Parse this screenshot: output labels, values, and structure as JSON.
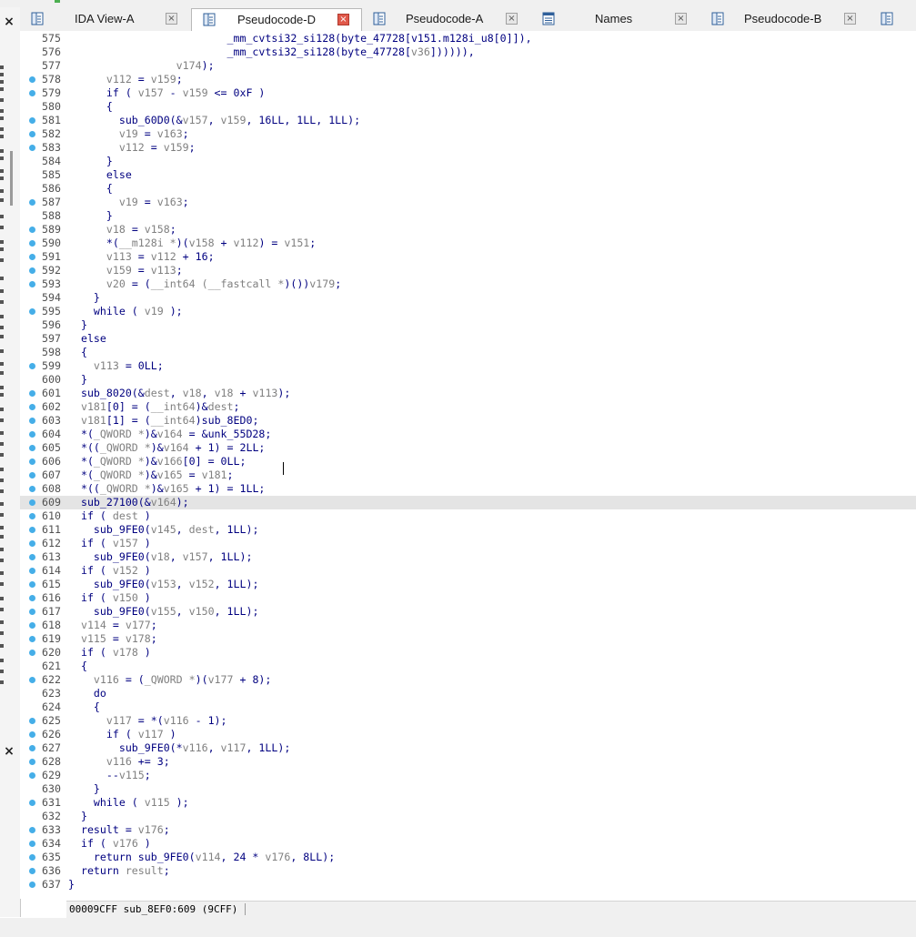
{
  "tabs": [
    {
      "label": "IDA View-A",
      "icon": "disassembly-icon",
      "active": false
    },
    {
      "label": "Pseudocode-D",
      "icon": "pseudocode-icon",
      "active": true
    },
    {
      "label": "Pseudocode-A",
      "icon": "pseudocode-icon",
      "active": false
    },
    {
      "label": "Names",
      "icon": "names-icon",
      "active": false
    },
    {
      "label": "Pseudocode-B",
      "icon": "pseudocode-icon",
      "active": false
    }
  ],
  "close_glyph": "×",
  "left_panel": {
    "close_glyph": "×"
  },
  "current_line": 609,
  "code_lines": [
    {
      "n": "575",
      "bp": false,
      "segs": [
        [
          "                         ",
          ""
        ],
        [
          "_mm_cvtsi32_si128(byte_47728[",
          ""
        ],
        [
          "v151",
          ""
        ],
        [
          ".m128i_u8[0]]),",
          ""
        ]
      ]
    },
    {
      "n": "576",
      "bp": false,
      "segs": [
        [
          "                         _mm_cvtsi32_si128(byte_47728[",
          ""
        ],
        [
          "v36",
          "v"
        ],
        [
          "]))))),",
          ""
        ]
      ]
    },
    {
      "n": "577",
      "bp": false,
      "segs": [
        [
          "                 ",
          ""
        ],
        [
          "v174",
          "v"
        ],
        [
          ");",
          ""
        ]
      ]
    },
    {
      "n": "578",
      "bp": true,
      "segs": [
        [
          "      ",
          ""
        ],
        [
          "v112",
          "v"
        ],
        [
          " = ",
          ""
        ],
        [
          "v159",
          "v"
        ],
        [
          ";",
          ""
        ]
      ]
    },
    {
      "n": "579",
      "bp": true,
      "segs": [
        [
          "      if ( ",
          ""
        ],
        [
          "v157",
          "v"
        ],
        [
          " - ",
          ""
        ],
        [
          "v159",
          "v"
        ],
        [
          " <= 0xF )",
          ""
        ]
      ]
    },
    {
      "n": "580",
      "bp": false,
      "segs": [
        [
          "      {",
          ""
        ]
      ]
    },
    {
      "n": "581",
      "bp": true,
      "segs": [
        [
          "        sub_60D0(&",
          ""
        ],
        [
          "v157",
          "v"
        ],
        [
          ", ",
          ""
        ],
        [
          "v159",
          "v"
        ],
        [
          ", 16LL, 1LL, 1LL);",
          ""
        ]
      ]
    },
    {
      "n": "582",
      "bp": true,
      "segs": [
        [
          "        ",
          ""
        ],
        [
          "v19",
          "v"
        ],
        [
          " = ",
          ""
        ],
        [
          "v163",
          "v"
        ],
        [
          ";",
          ""
        ]
      ]
    },
    {
      "n": "583",
      "bp": true,
      "segs": [
        [
          "        ",
          ""
        ],
        [
          "v112",
          "v"
        ],
        [
          " = ",
          ""
        ],
        [
          "v159",
          "v"
        ],
        [
          ";",
          ""
        ]
      ]
    },
    {
      "n": "584",
      "bp": false,
      "segs": [
        [
          "      }",
          ""
        ]
      ]
    },
    {
      "n": "585",
      "bp": false,
      "segs": [
        [
          "      else",
          ""
        ]
      ]
    },
    {
      "n": "586",
      "bp": false,
      "segs": [
        [
          "      {",
          ""
        ]
      ]
    },
    {
      "n": "587",
      "bp": true,
      "segs": [
        [
          "        ",
          ""
        ],
        [
          "v19",
          "v"
        ],
        [
          " = ",
          ""
        ],
        [
          "v163",
          "v"
        ],
        [
          ";",
          ""
        ]
      ]
    },
    {
      "n": "588",
      "bp": false,
      "segs": [
        [
          "      }",
          ""
        ]
      ]
    },
    {
      "n": "589",
      "bp": true,
      "segs": [
        [
          "      ",
          ""
        ],
        [
          "v18",
          "v"
        ],
        [
          " = ",
          ""
        ],
        [
          "v158",
          "v"
        ],
        [
          ";",
          ""
        ]
      ]
    },
    {
      "n": "590",
      "bp": true,
      "segs": [
        [
          "      *(",
          ""
        ],
        [
          "__m128i *",
          "v"
        ],
        [
          ")(",
          ""
        ],
        [
          "v158",
          "v"
        ],
        [
          " + ",
          ""
        ],
        [
          "v112",
          "v"
        ],
        [
          ") = ",
          ""
        ],
        [
          "v151",
          "v"
        ],
        [
          ";",
          ""
        ]
      ]
    },
    {
      "n": "591",
      "bp": true,
      "segs": [
        [
          "      ",
          ""
        ],
        [
          "v113",
          "v"
        ],
        [
          " = ",
          ""
        ],
        [
          "v112",
          "v"
        ],
        [
          " + 16;",
          ""
        ]
      ]
    },
    {
      "n": "592",
      "bp": true,
      "segs": [
        [
          "      ",
          ""
        ],
        [
          "v159",
          "v"
        ],
        [
          " = ",
          ""
        ],
        [
          "v113",
          "v"
        ],
        [
          ";",
          ""
        ]
      ]
    },
    {
      "n": "593",
      "bp": true,
      "segs": [
        [
          "      ",
          ""
        ],
        [
          "v20",
          "v"
        ],
        [
          " = (",
          ""
        ],
        [
          "__int64 (__fastcall *",
          "v"
        ],
        [
          ")())",
          ""
        ],
        [
          "v179",
          "v"
        ],
        [
          ";",
          ""
        ]
      ]
    },
    {
      "n": "594",
      "bp": false,
      "segs": [
        [
          "    }",
          ""
        ]
      ]
    },
    {
      "n": "595",
      "bp": true,
      "segs": [
        [
          "    while ( ",
          ""
        ],
        [
          "v19",
          "v"
        ],
        [
          " );",
          ""
        ]
      ]
    },
    {
      "n": "596",
      "bp": false,
      "segs": [
        [
          "  }",
          ""
        ]
      ]
    },
    {
      "n": "597",
      "bp": false,
      "segs": [
        [
          "  else",
          ""
        ]
      ]
    },
    {
      "n": "598",
      "bp": false,
      "segs": [
        [
          "  {",
          ""
        ]
      ]
    },
    {
      "n": "599",
      "bp": true,
      "segs": [
        [
          "    ",
          ""
        ],
        [
          "v113",
          "v"
        ],
        [
          " = 0LL;",
          ""
        ]
      ]
    },
    {
      "n": "600",
      "bp": false,
      "segs": [
        [
          "  }",
          ""
        ]
      ]
    },
    {
      "n": "601",
      "bp": true,
      "segs": [
        [
          "  sub_8020(&",
          ""
        ],
        [
          "dest",
          "v"
        ],
        [
          ", ",
          ""
        ],
        [
          "v18",
          "v"
        ],
        [
          ", ",
          ""
        ],
        [
          "v18",
          "v"
        ],
        [
          " + ",
          ""
        ],
        [
          "v113",
          "v"
        ],
        [
          ");",
          ""
        ]
      ]
    },
    {
      "n": "602",
      "bp": true,
      "segs": [
        [
          "  ",
          ""
        ],
        [
          "v181",
          "v"
        ],
        [
          "[0] = (",
          ""
        ],
        [
          "__int64",
          "v"
        ],
        [
          ")&",
          ""
        ],
        [
          "dest",
          "v"
        ],
        [
          ";",
          ""
        ]
      ]
    },
    {
      "n": "603",
      "bp": true,
      "segs": [
        [
          "  ",
          ""
        ],
        [
          "v181",
          "v"
        ],
        [
          "[1] = (",
          ""
        ],
        [
          "__int64",
          "v"
        ],
        [
          ")sub_8ED0;",
          ""
        ]
      ]
    },
    {
      "n": "604",
      "bp": true,
      "segs": [
        [
          "  *(",
          ""
        ],
        [
          "_QWORD *",
          "v"
        ],
        [
          ")&",
          ""
        ],
        [
          "v164",
          "v"
        ],
        [
          " = &unk_55D28;",
          ""
        ]
      ]
    },
    {
      "n": "605",
      "bp": true,
      "segs": [
        [
          "  *((",
          ""
        ],
        [
          "_QWORD *",
          "v"
        ],
        [
          ")&",
          ""
        ],
        [
          "v164",
          "v"
        ],
        [
          " + 1) = 2LL;",
          ""
        ]
      ]
    },
    {
      "n": "606",
      "bp": true,
      "segs": [
        [
          "  *(",
          ""
        ],
        [
          "_QWORD *",
          "v"
        ],
        [
          ")&",
          ""
        ],
        [
          "v166",
          "v"
        ],
        [
          "[0] = 0LL;",
          ""
        ]
      ]
    },
    {
      "n": "607",
      "bp": true,
      "segs": [
        [
          "  *(",
          ""
        ],
        [
          "_QWORD *",
          "v"
        ],
        [
          ")&",
          ""
        ],
        [
          "v165",
          "v"
        ],
        [
          " = ",
          ""
        ],
        [
          "v181",
          "v"
        ],
        [
          ";",
          ""
        ]
      ]
    },
    {
      "n": "608",
      "bp": true,
      "segs": [
        [
          "  *((",
          ""
        ],
        [
          "_QWORD *",
          "v"
        ],
        [
          ")&",
          ""
        ],
        [
          "v165",
          "v"
        ],
        [
          " + 1) = 1LL;",
          ""
        ]
      ]
    },
    {
      "n": "609",
      "bp": true,
      "segs": [
        [
          "  sub_27100(&",
          ""
        ],
        [
          "v164",
          "v"
        ],
        [
          ");",
          ""
        ]
      ]
    },
    {
      "n": "610",
      "bp": true,
      "segs": [
        [
          "  if ( ",
          ""
        ],
        [
          "dest",
          "v"
        ],
        [
          " )",
          ""
        ]
      ]
    },
    {
      "n": "611",
      "bp": true,
      "segs": [
        [
          "    sub_9FE0(",
          ""
        ],
        [
          "v145",
          "v"
        ],
        [
          ", ",
          ""
        ],
        [
          "dest",
          "v"
        ],
        [
          ", 1LL);",
          ""
        ]
      ]
    },
    {
      "n": "612",
      "bp": true,
      "segs": [
        [
          "  if ( ",
          ""
        ],
        [
          "v157",
          "v"
        ],
        [
          " )",
          ""
        ]
      ]
    },
    {
      "n": "613",
      "bp": true,
      "segs": [
        [
          "    sub_9FE0(",
          ""
        ],
        [
          "v18",
          "v"
        ],
        [
          ", ",
          ""
        ],
        [
          "v157",
          "v"
        ],
        [
          ", 1LL);",
          ""
        ]
      ]
    },
    {
      "n": "614",
      "bp": true,
      "segs": [
        [
          "  if ( ",
          ""
        ],
        [
          "v152",
          "v"
        ],
        [
          " )",
          ""
        ]
      ]
    },
    {
      "n": "615",
      "bp": true,
      "segs": [
        [
          "    sub_9FE0(",
          ""
        ],
        [
          "v153",
          "v"
        ],
        [
          ", ",
          ""
        ],
        [
          "v152",
          "v"
        ],
        [
          ", 1LL);",
          ""
        ]
      ]
    },
    {
      "n": "616",
      "bp": true,
      "segs": [
        [
          "  if ( ",
          ""
        ],
        [
          "v150",
          "v"
        ],
        [
          " )",
          ""
        ]
      ]
    },
    {
      "n": "617",
      "bp": true,
      "segs": [
        [
          "    sub_9FE0(",
          ""
        ],
        [
          "v155",
          "v"
        ],
        [
          ", ",
          ""
        ],
        [
          "v150",
          "v"
        ],
        [
          ", 1LL);",
          ""
        ]
      ]
    },
    {
      "n": "618",
      "bp": true,
      "segs": [
        [
          "  ",
          ""
        ],
        [
          "v114",
          "v"
        ],
        [
          " = ",
          ""
        ],
        [
          "v177",
          "v"
        ],
        [
          ";",
          ""
        ]
      ]
    },
    {
      "n": "619",
      "bp": true,
      "segs": [
        [
          "  ",
          ""
        ],
        [
          "v115",
          "v"
        ],
        [
          " = ",
          ""
        ],
        [
          "v178",
          "v"
        ],
        [
          ";",
          ""
        ]
      ]
    },
    {
      "n": "620",
      "bp": true,
      "segs": [
        [
          "  if ( ",
          ""
        ],
        [
          "v178",
          "v"
        ],
        [
          " )",
          ""
        ]
      ]
    },
    {
      "n": "621",
      "bp": false,
      "segs": [
        [
          "  {",
          ""
        ]
      ]
    },
    {
      "n": "622",
      "bp": true,
      "segs": [
        [
          "    ",
          ""
        ],
        [
          "v116",
          "v"
        ],
        [
          " = (",
          ""
        ],
        [
          "_QWORD *",
          "v"
        ],
        [
          ")(",
          ""
        ],
        [
          "v177",
          "v"
        ],
        [
          " + 8);",
          ""
        ]
      ]
    },
    {
      "n": "623",
      "bp": false,
      "segs": [
        [
          "    do",
          ""
        ]
      ]
    },
    {
      "n": "624",
      "bp": false,
      "segs": [
        [
          "    {",
          ""
        ]
      ]
    },
    {
      "n": "625",
      "bp": true,
      "segs": [
        [
          "      ",
          ""
        ],
        [
          "v117",
          "v"
        ],
        [
          " = *(",
          ""
        ],
        [
          "v116",
          "v"
        ],
        [
          " - 1);",
          ""
        ]
      ]
    },
    {
      "n": "626",
      "bp": true,
      "segs": [
        [
          "      if ( ",
          ""
        ],
        [
          "v117",
          "v"
        ],
        [
          " )",
          ""
        ]
      ]
    },
    {
      "n": "627",
      "bp": true,
      "segs": [
        [
          "        sub_9FE0(*",
          ""
        ],
        [
          "v116",
          "v"
        ],
        [
          ", ",
          ""
        ],
        [
          "v117",
          "v"
        ],
        [
          ", 1LL);",
          ""
        ]
      ]
    },
    {
      "n": "628",
      "bp": true,
      "segs": [
        [
          "      ",
          ""
        ],
        [
          "v116",
          "v"
        ],
        [
          " += 3;",
          ""
        ]
      ]
    },
    {
      "n": "629",
      "bp": true,
      "segs": [
        [
          "      --",
          ""
        ],
        [
          "v115",
          "v"
        ],
        [
          ";",
          ""
        ]
      ]
    },
    {
      "n": "630",
      "bp": false,
      "segs": [
        [
          "    }",
          ""
        ]
      ]
    },
    {
      "n": "631",
      "bp": true,
      "segs": [
        [
          "    while ( ",
          ""
        ],
        [
          "v115",
          "v"
        ],
        [
          " );",
          ""
        ]
      ]
    },
    {
      "n": "632",
      "bp": false,
      "segs": [
        [
          "  }",
          ""
        ]
      ]
    },
    {
      "n": "633",
      "bp": true,
      "segs": [
        [
          "  result = ",
          ""
        ],
        [
          "v176",
          "v"
        ],
        [
          ";",
          ""
        ]
      ]
    },
    {
      "n": "634",
      "bp": true,
      "segs": [
        [
          "  if ( ",
          ""
        ],
        [
          "v176",
          "v"
        ],
        [
          " )",
          ""
        ]
      ]
    },
    {
      "n": "635",
      "bp": true,
      "segs": [
        [
          "    return sub_9FE0(",
          ""
        ],
        [
          "v114",
          "v"
        ],
        [
          ", 24 * ",
          ""
        ],
        [
          "v176",
          "v"
        ],
        [
          ", 8LL);",
          ""
        ]
      ]
    },
    {
      "n": "636",
      "bp": true,
      "segs": [
        [
          "  return ",
          ""
        ],
        [
          "result",
          "v"
        ],
        [
          ";",
          ""
        ]
      ]
    },
    {
      "n": "637",
      "bp": true,
      "segs": [
        [
          "}",
          ""
        ]
      ]
    }
  ],
  "status": {
    "text": "00009CFF sub_8EF0:609 (9CFF)"
  },
  "colors": {
    "keyword": "#000080",
    "variable": "#808080",
    "line_number": "#505050",
    "breakpoint": "#45aee8",
    "current_line_bg": "#e4e4e4",
    "active_tab_close": "#e0584a"
  }
}
